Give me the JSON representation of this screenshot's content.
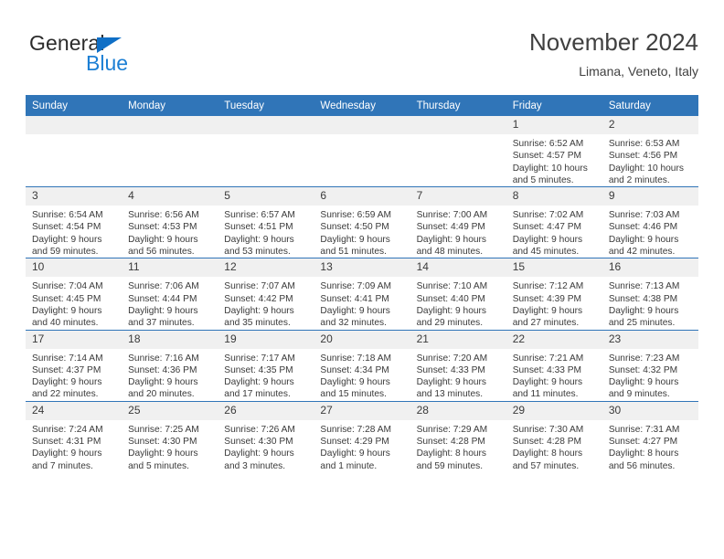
{
  "brand": {
    "name_part1": "General",
    "name_part2": "Blue",
    "triangle_color": "#0F6FC6",
    "blue_color": "#1C7FD4"
  },
  "header": {
    "title": "November 2024",
    "subtitle": "Limana, Veneto, Italy"
  },
  "theme": {
    "header_blue": "#3075B8",
    "daynum_gray": "#F0F0F0",
    "text_color": "#3a3a3a"
  },
  "weekday_headers": [
    "Sunday",
    "Monday",
    "Tuesday",
    "Wednesday",
    "Thursday",
    "Friday",
    "Saturday"
  ],
  "weeks": [
    [
      {
        "day": "",
        "sunrise": "",
        "sunset": "",
        "daylight1": "",
        "daylight2": ""
      },
      {
        "day": "",
        "sunrise": "",
        "sunset": "",
        "daylight1": "",
        "daylight2": ""
      },
      {
        "day": "",
        "sunrise": "",
        "sunset": "",
        "daylight1": "",
        "daylight2": ""
      },
      {
        "day": "",
        "sunrise": "",
        "sunset": "",
        "daylight1": "",
        "daylight2": ""
      },
      {
        "day": "",
        "sunrise": "",
        "sunset": "",
        "daylight1": "",
        "daylight2": ""
      },
      {
        "day": "1",
        "sunrise": "Sunrise: 6:52 AM",
        "sunset": "Sunset: 4:57 PM",
        "daylight1": "Daylight: 10 hours",
        "daylight2": "and 5 minutes."
      },
      {
        "day": "2",
        "sunrise": "Sunrise: 6:53 AM",
        "sunset": "Sunset: 4:56 PM",
        "daylight1": "Daylight: 10 hours",
        "daylight2": "and 2 minutes."
      }
    ],
    [
      {
        "day": "3",
        "sunrise": "Sunrise: 6:54 AM",
        "sunset": "Sunset: 4:54 PM",
        "daylight1": "Daylight: 9 hours",
        "daylight2": "and 59 minutes."
      },
      {
        "day": "4",
        "sunrise": "Sunrise: 6:56 AM",
        "sunset": "Sunset: 4:53 PM",
        "daylight1": "Daylight: 9 hours",
        "daylight2": "and 56 minutes."
      },
      {
        "day": "5",
        "sunrise": "Sunrise: 6:57 AM",
        "sunset": "Sunset: 4:51 PM",
        "daylight1": "Daylight: 9 hours",
        "daylight2": "and 53 minutes."
      },
      {
        "day": "6",
        "sunrise": "Sunrise: 6:59 AM",
        "sunset": "Sunset: 4:50 PM",
        "daylight1": "Daylight: 9 hours",
        "daylight2": "and 51 minutes."
      },
      {
        "day": "7",
        "sunrise": "Sunrise: 7:00 AM",
        "sunset": "Sunset: 4:49 PM",
        "daylight1": "Daylight: 9 hours",
        "daylight2": "and 48 minutes."
      },
      {
        "day": "8",
        "sunrise": "Sunrise: 7:02 AM",
        "sunset": "Sunset: 4:47 PM",
        "daylight1": "Daylight: 9 hours",
        "daylight2": "and 45 minutes."
      },
      {
        "day": "9",
        "sunrise": "Sunrise: 7:03 AM",
        "sunset": "Sunset: 4:46 PM",
        "daylight1": "Daylight: 9 hours",
        "daylight2": "and 42 minutes."
      }
    ],
    [
      {
        "day": "10",
        "sunrise": "Sunrise: 7:04 AM",
        "sunset": "Sunset: 4:45 PM",
        "daylight1": "Daylight: 9 hours",
        "daylight2": "and 40 minutes."
      },
      {
        "day": "11",
        "sunrise": "Sunrise: 7:06 AM",
        "sunset": "Sunset: 4:44 PM",
        "daylight1": "Daylight: 9 hours",
        "daylight2": "and 37 minutes."
      },
      {
        "day": "12",
        "sunrise": "Sunrise: 7:07 AM",
        "sunset": "Sunset: 4:42 PM",
        "daylight1": "Daylight: 9 hours",
        "daylight2": "and 35 minutes."
      },
      {
        "day": "13",
        "sunrise": "Sunrise: 7:09 AM",
        "sunset": "Sunset: 4:41 PM",
        "daylight1": "Daylight: 9 hours",
        "daylight2": "and 32 minutes."
      },
      {
        "day": "14",
        "sunrise": "Sunrise: 7:10 AM",
        "sunset": "Sunset: 4:40 PM",
        "daylight1": "Daylight: 9 hours",
        "daylight2": "and 29 minutes."
      },
      {
        "day": "15",
        "sunrise": "Sunrise: 7:12 AM",
        "sunset": "Sunset: 4:39 PM",
        "daylight1": "Daylight: 9 hours",
        "daylight2": "and 27 minutes."
      },
      {
        "day": "16",
        "sunrise": "Sunrise: 7:13 AM",
        "sunset": "Sunset: 4:38 PM",
        "daylight1": "Daylight: 9 hours",
        "daylight2": "and 25 minutes."
      }
    ],
    [
      {
        "day": "17",
        "sunrise": "Sunrise: 7:14 AM",
        "sunset": "Sunset: 4:37 PM",
        "daylight1": "Daylight: 9 hours",
        "daylight2": "and 22 minutes."
      },
      {
        "day": "18",
        "sunrise": "Sunrise: 7:16 AM",
        "sunset": "Sunset: 4:36 PM",
        "daylight1": "Daylight: 9 hours",
        "daylight2": "and 20 minutes."
      },
      {
        "day": "19",
        "sunrise": "Sunrise: 7:17 AM",
        "sunset": "Sunset: 4:35 PM",
        "daylight1": "Daylight: 9 hours",
        "daylight2": "and 17 minutes."
      },
      {
        "day": "20",
        "sunrise": "Sunrise: 7:18 AM",
        "sunset": "Sunset: 4:34 PM",
        "daylight1": "Daylight: 9 hours",
        "daylight2": "and 15 minutes."
      },
      {
        "day": "21",
        "sunrise": "Sunrise: 7:20 AM",
        "sunset": "Sunset: 4:33 PM",
        "daylight1": "Daylight: 9 hours",
        "daylight2": "and 13 minutes."
      },
      {
        "day": "22",
        "sunrise": "Sunrise: 7:21 AM",
        "sunset": "Sunset: 4:33 PM",
        "daylight1": "Daylight: 9 hours",
        "daylight2": "and 11 minutes."
      },
      {
        "day": "23",
        "sunrise": "Sunrise: 7:23 AM",
        "sunset": "Sunset: 4:32 PM",
        "daylight1": "Daylight: 9 hours",
        "daylight2": "and 9 minutes."
      }
    ],
    [
      {
        "day": "24",
        "sunrise": "Sunrise: 7:24 AM",
        "sunset": "Sunset: 4:31 PM",
        "daylight1": "Daylight: 9 hours",
        "daylight2": "and 7 minutes."
      },
      {
        "day": "25",
        "sunrise": "Sunrise: 7:25 AM",
        "sunset": "Sunset: 4:30 PM",
        "daylight1": "Daylight: 9 hours",
        "daylight2": "and 5 minutes."
      },
      {
        "day": "26",
        "sunrise": "Sunrise: 7:26 AM",
        "sunset": "Sunset: 4:30 PM",
        "daylight1": "Daylight: 9 hours",
        "daylight2": "and 3 minutes."
      },
      {
        "day": "27",
        "sunrise": "Sunrise: 7:28 AM",
        "sunset": "Sunset: 4:29 PM",
        "daylight1": "Daylight: 9 hours",
        "daylight2": "and 1 minute."
      },
      {
        "day": "28",
        "sunrise": "Sunrise: 7:29 AM",
        "sunset": "Sunset: 4:28 PM",
        "daylight1": "Daylight: 8 hours",
        "daylight2": "and 59 minutes."
      },
      {
        "day": "29",
        "sunrise": "Sunrise: 7:30 AM",
        "sunset": "Sunset: 4:28 PM",
        "daylight1": "Daylight: 8 hours",
        "daylight2": "and 57 minutes."
      },
      {
        "day": "30",
        "sunrise": "Sunrise: 7:31 AM",
        "sunset": "Sunset: 4:27 PM",
        "daylight1": "Daylight: 8 hours",
        "daylight2": "and 56 minutes."
      }
    ]
  ]
}
